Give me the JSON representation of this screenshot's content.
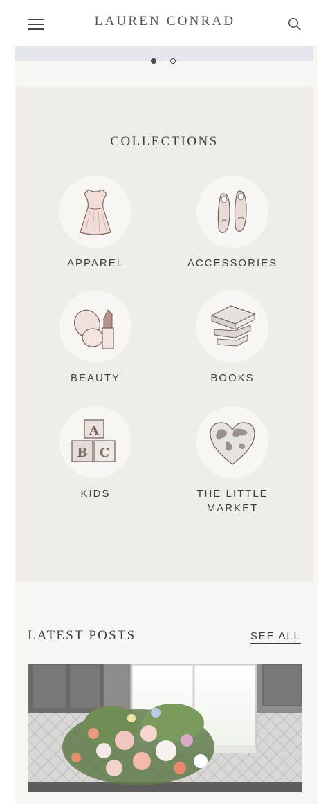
{
  "header": {
    "logo": "LAUREN CONRAD",
    "menu_icon": "hamburger-menu-icon",
    "search_icon": "search-icon"
  },
  "carousel": {
    "slides": 2,
    "active_slide": 1
  },
  "collections": {
    "title": "COLLECTIONS",
    "items": [
      {
        "label": "APPAREL",
        "icon": "dress-icon"
      },
      {
        "label": "ACCESSORIES",
        "icon": "ballet-flats-icon"
      },
      {
        "label": "BEAUTY",
        "icon": "compact-lipstick-icon"
      },
      {
        "label": "BOOKS",
        "icon": "book-stack-icon"
      },
      {
        "label": "KIDS",
        "icon": "abc-blocks-icon"
      },
      {
        "label": "THE LITTLE\nMARKET",
        "icon": "heart-globe-icon"
      }
    ]
  },
  "latest_posts": {
    "title": "LATEST POSTS",
    "see_all": "SEE ALL",
    "post_image": "flower-bouquet-kitchen-photo"
  },
  "colors": {
    "collections_bg": "#f0ede9",
    "page_bg": "#f8f6f3",
    "text": "#3e3e3e"
  }
}
